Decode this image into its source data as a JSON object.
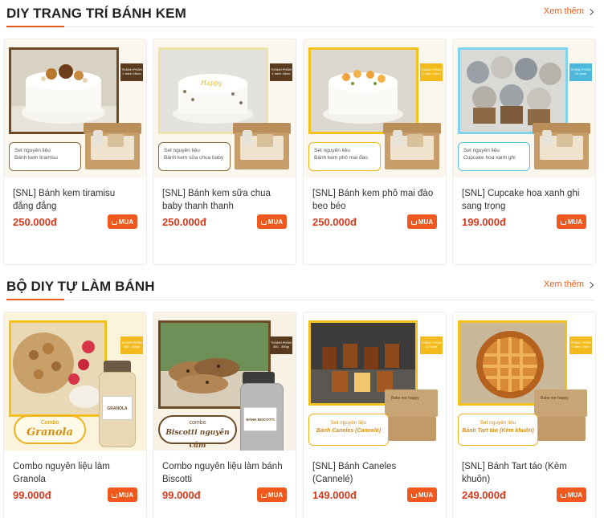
{
  "sections": [
    {
      "title": "DIY TRANG TRÍ BÁNH KEM",
      "see_more": "Xem thêm",
      "products": [
        {
          "name": "[SNL] Bánh kem tiramisu đắng đắng",
          "price": "250.000đ",
          "buy_label": "MUA",
          "image_tag": "THÀNH PHẦN 1 bánh 16cm",
          "image_label_line1": "Set nguyên liệu",
          "image_label_line2": "Bánh kem tiramisu"
        },
        {
          "name": "[SNL] Bánh kem sữa chua baby thanh thanh",
          "price": "250.000đ",
          "buy_label": "MUA",
          "image_tag": "THÀNH PHẦN 1 bánh 16cm",
          "image_label_line1": "Set nguyên liệu",
          "image_label_line2": "Bánh kem sữa chua baby"
        },
        {
          "name": "[SNL] Bánh kem phô mai đào beo béo",
          "price": "250.000đ",
          "buy_label": "MUA",
          "image_tag": "THÀNH PHẦN 1 bánh 16cm",
          "image_label_line1": "Set nguyên liệu",
          "image_label_line2": "Bánh kem phô mai đào"
        },
        {
          "name": "[SNL] Cupcake hoa xanh ghi sang trọng",
          "price": "199.000đ",
          "buy_label": "MUA",
          "image_tag": "THÀNH PHẦN 12 bánh",
          "image_label_line1": "Set nguyên liệu",
          "image_label_line2": "Cupcake hoa xanh ghi"
        }
      ]
    },
    {
      "title": "BỘ DIY TỰ LÀM BÁNH",
      "see_more": "Xem thêm",
      "products": [
        {
          "name": "Combo nguyên liệu làm Granola",
          "price": "99.000đ",
          "buy_label": "MUA",
          "image_tag": "THÀNH PHẦN 300 - 350gr",
          "image_label_line1": "Combo",
          "image_label_line2": "Granola",
          "jar_label": "GRANOLA"
        },
        {
          "name": "Combo nguyên liệu làm bánh Biscotti",
          "price": "99.000đ",
          "buy_label": "MUA",
          "image_tag": "THÀNH PHẦN 300 - 350gr",
          "image_label_line1": "combo",
          "image_label_line2": "Biscotti nguyên cám",
          "jar_label": "BÁNH BISCOTTI"
        },
        {
          "name": "[SNL] Bánh Caneles (Cannelé)",
          "price": "149.000đ",
          "buy_label": "MUA",
          "image_tag": "THÀNH PHẦN 12 bánh",
          "image_label_line1": "Set nguyên liệu",
          "image_label_line2": "Bánh Caneles (Cannelé)",
          "box_label": "Bake me happy"
        },
        {
          "name": "[SNL] Bánh Tart táo (Kèm khuôn)",
          "price": "249.000đ",
          "buy_label": "MUA",
          "image_tag": "THÀNH PHẦN 1 bánh 16cm",
          "image_label_line1": "Set nguyên liệu",
          "image_label_line2": "Bánh Tart táo (Kèm khuôn)",
          "box_label": "Bake me happy"
        }
      ]
    }
  ],
  "colors": {
    "accent": "#e85d1c",
    "price": "#d63b1f",
    "buy_button": "#f0581e"
  },
  "icons": {
    "see_more": "chevron-right-icon",
    "buy": "cart-icon"
  }
}
